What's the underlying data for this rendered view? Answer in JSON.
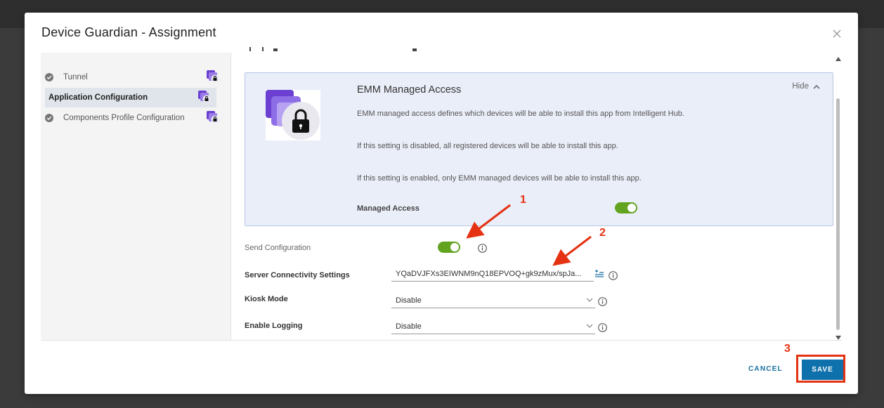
{
  "modal": {
    "title": "Device Guardian - Assignment"
  },
  "nav": {
    "items": [
      {
        "label": "Tunnel",
        "state": "completed",
        "locked": true
      },
      {
        "label": "Application Configuration",
        "state": "active",
        "locked": true
      },
      {
        "label": "Components Profile Configuration",
        "state": "completed",
        "locked": true
      }
    ]
  },
  "emm": {
    "title": "EMM Managed Access",
    "hide_label": "Hide",
    "description_1": "EMM managed access defines which devices will be able to install this app from Intelligent Hub.",
    "description_2": "If this setting is disabled, all registered devices will be able to install this app.",
    "description_3": "If this setting is enabled, only EMM managed devices will be able to install this app.",
    "managed_access_label": "Managed Access",
    "managed_access_enabled": true
  },
  "form": {
    "send_configuration_label": "Send Configuration",
    "send_configuration_enabled": true,
    "server_connectivity_label": "Server Connectivity Settings",
    "server_connectivity_value": "YQaDVJFXs3EIWNM9nQ18EPVOQ+gk9zMux/spJa...",
    "kiosk_mode_label": "Kiosk Mode",
    "kiosk_mode_value": "Disable",
    "enable_logging_label": "Enable Logging",
    "enable_logging_value": "Disable"
  },
  "footer": {
    "cancel_label": "CANCEL",
    "save_label": "SAVE"
  },
  "annotations": {
    "step_1": "1",
    "step_2": "2",
    "step_3": "3",
    "color": "#e53212"
  },
  "colors": {
    "toggle_on": "#62a420",
    "primary": "#0f71ab",
    "nav_lock_badge": "#6a3fd1"
  }
}
